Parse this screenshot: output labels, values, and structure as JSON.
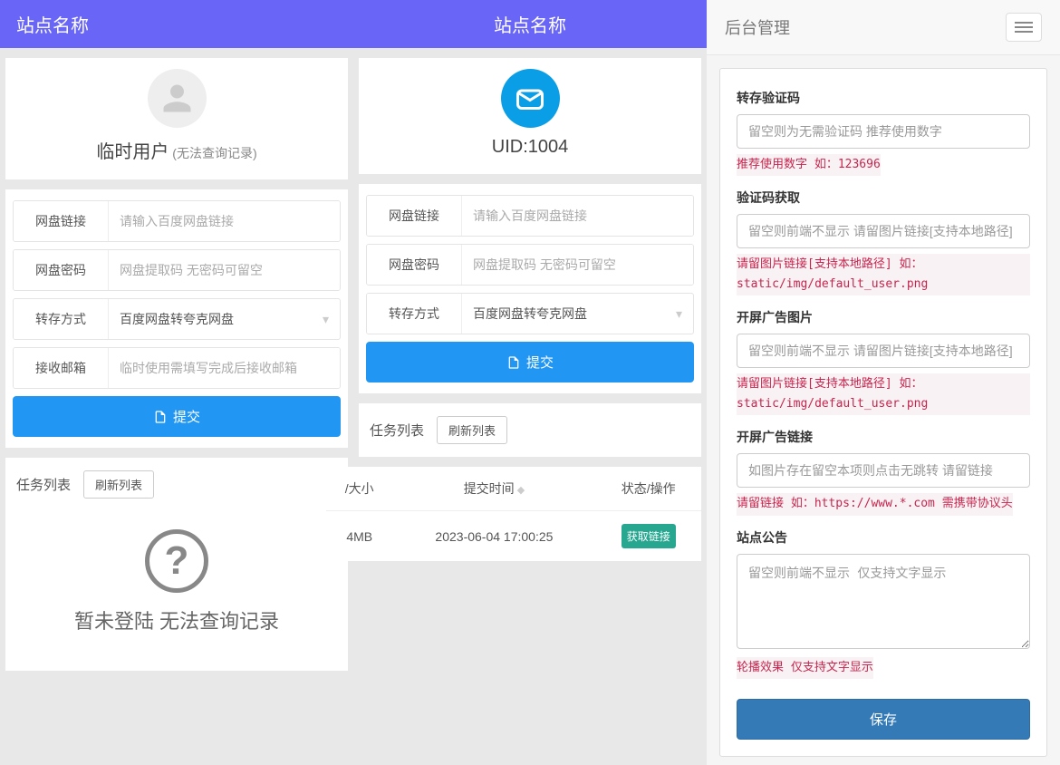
{
  "left": {
    "site_name": "站点名称",
    "user": {
      "name": "临时用户",
      "sub": "(无法查询记录)"
    },
    "form": {
      "link_label": "网盘链接",
      "link_placeholder": "请输入百度网盘链接",
      "pwd_label": "网盘密码",
      "pwd_placeholder": "网盘提取码 无密码可留空",
      "method_label": "转存方式",
      "method_value": "百度网盘转夸克网盘",
      "email_label": "接收邮箱",
      "email_placeholder": "临时使用需填写完成后接收邮箱"
    },
    "submit": "提交",
    "task": {
      "title": "任务列表",
      "refresh": "刷新列表",
      "empty": "暂未登陆 无法查询记录"
    }
  },
  "mid": {
    "site_name": "站点名称",
    "uid": "UID:1004",
    "form": {
      "link_label": "网盘链接",
      "link_placeholder": "请输入百度网盘链接",
      "pwd_label": "网盘密码",
      "pwd_placeholder": "网盘提取码 无密码可留空",
      "method_label": "转存方式",
      "method_value": "百度网盘转夸克网盘"
    },
    "submit": "提交",
    "task": {
      "title": "任务列表",
      "refresh": "刷新列表"
    },
    "table": {
      "cols": {
        "size": "/大小",
        "time": "提交时间",
        "status": "状态/操作"
      },
      "row": {
        "size": "4MB",
        "time": "2023-06-04 17:00:25",
        "action": "获取链接"
      }
    }
  },
  "right": {
    "title": "后台管理",
    "fields": {
      "f1": {
        "label": "转存验证码",
        "placeholder": "留空则为无需验证码 推荐使用数字",
        "hint": "推荐使用数字 如：123696"
      },
      "f2": {
        "label": "验证码获取",
        "placeholder": "留空则前端不显示 请留图片链接[支持本地路径]",
        "hint": "请留图片链接[支持本地路径] 如：static/img/default_user.png"
      },
      "f3": {
        "label": "开屏广告图片",
        "placeholder": "留空则前端不显示 请留图片链接[支持本地路径]",
        "hint": "请留图片链接[支持本地路径] 如：static/img/default_user.png"
      },
      "f4": {
        "label": "开屏广告链接",
        "placeholder": "如图片存在留空本项则点击无跳转 请留链接",
        "hint": "请留链接 如：https://www.*.com 需携带协议头"
      },
      "f5": {
        "label": "站点公告",
        "placeholder": "留空则前端不显示 仅支持文字显示",
        "hint": "轮播效果 仅支持文字显示"
      }
    },
    "save": "保存"
  }
}
